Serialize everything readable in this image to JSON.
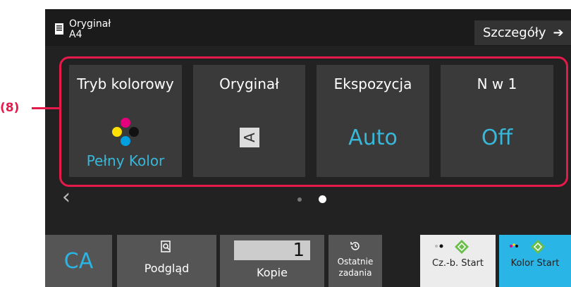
{
  "header": {
    "original_label": "Oryginał",
    "original_size": "A4",
    "details_label": "Szczegóły",
    "details_arrow": "➔"
  },
  "callout": {
    "label": "(8)"
  },
  "tiles": [
    {
      "title": "Tryb kolorowy",
      "value": "Pełny Kolor",
      "icon": "color-dots-icon"
    },
    {
      "title": "Oryginał",
      "value": "A",
      "icon": "orientation-icon"
    },
    {
      "title": "Ekspozycja",
      "value": "Auto"
    },
    {
      "title": "N w 1",
      "value": "Off"
    }
  ],
  "nav": {
    "prev": "‹",
    "page_count": 2,
    "current_page": 2
  },
  "bottom": {
    "ca_label": "CA",
    "preview_label": "Podgląd",
    "copies_value": "1",
    "copies_label": "Kopie",
    "recent_label": "Ostatnie zadania",
    "bw_start_label": "Cz.-b. Start",
    "color_start_label": "Kolor Start"
  },
  "colors": {
    "accent": "#29b6e6",
    "highlight": "#e5194a",
    "tile_bg": "#3a3a3a",
    "start_green": "#6abf4b"
  }
}
